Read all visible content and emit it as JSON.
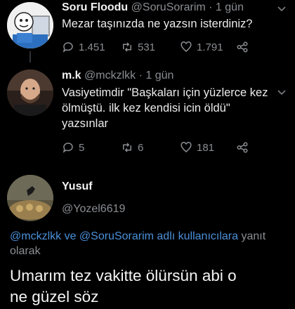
{
  "tweets": [
    {
      "name": "Soru Floodu",
      "handle": "@SoruSorarim",
      "time": "· 1 gün",
      "text": "Mezar taşınızda ne yazsın isterdiniz?",
      "replies": "1.451",
      "retweets": "531",
      "likes": "1.791"
    },
    {
      "name": "m.k",
      "handle": "@mckzlkk",
      "time": "· 1 gün",
      "text_lines": [
        "Vasiyetimdir \"Başkaları için yüzlerce kez",
        "ölmüştü. ilk kez kendisi icin öldü\"",
        "yazsınlar"
      ],
      "replies": "5",
      "retweets": "6",
      "likes": "181"
    }
  ],
  "composer": {
    "name": "Yusuf",
    "handle": "@Yozel6619",
    "reply_to_link": "@mckzlkk ve @SoruSorarim adlı kullanıcılara",
    "reply_to_suffix": " yanıt",
    "reply_to_line2": "olarak",
    "reply_text_line1": "Umarım tez vakitte ölürsün abi o",
    "reply_text_line2": "ne güzel söz"
  },
  "icons": [
    "reply-icon",
    "retweet-icon",
    "like-icon",
    "share-icon",
    "chevron-down-icon"
  ],
  "colors": {
    "background": "#000000",
    "link": "#4a90d9",
    "muted": "#8a8d91"
  }
}
